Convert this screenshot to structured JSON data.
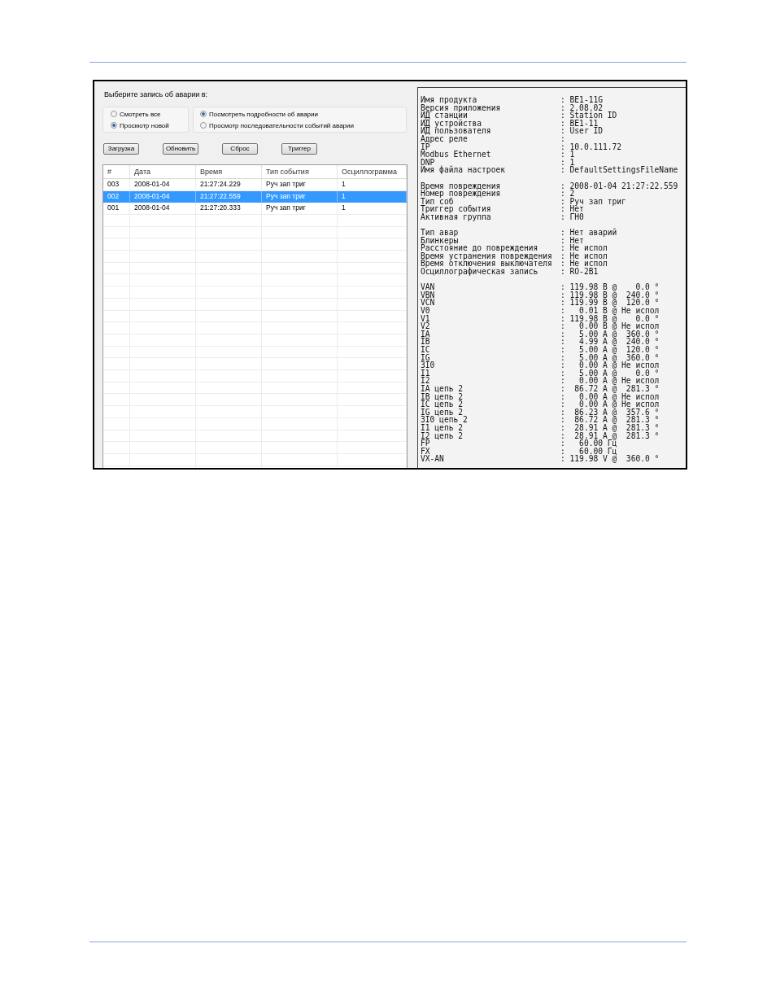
{
  "fault_dialog": {
    "prompt": "Выберите запись об аварии в:",
    "view_group": [
      {
        "label": "Смотреть все",
        "selected": false
      },
      {
        "label": "Просмотр новой",
        "selected": true
      }
    ],
    "detail_group": [
      {
        "label": "Посмотреть подробности об аварии",
        "selected": true
      },
      {
        "label": "Просмотр последовательности событий аварии",
        "selected": false
      }
    ],
    "buttons": [
      "Загрузка",
      "Обновить",
      "Сброс",
      "Триггер"
    ],
    "table": {
      "columns": [
        "#",
        "Дата",
        "Время",
        "Тип события",
        "Осциллограмма"
      ],
      "rows": [
        {
          "cells": [
            "003",
            "2008-01-04",
            "21:27:24.229",
            "Руч зап триг",
            "1"
          ],
          "selected": false
        },
        {
          "cells": [
            "002",
            "2008-01-04",
            "21:27:22.559",
            "Руч зап триг",
            "1"
          ],
          "selected": true
        },
        {
          "cells": [
            "001",
            "2008-01-04",
            "21:27:20.333",
            "Руч зап триг",
            "1"
          ],
          "selected": false
        }
      ]
    }
  },
  "report": {
    "sections": [
      {
        "rows": [
          {
            "label": "Имя продукта",
            "value": ": BE1-11G"
          },
          {
            "label": "Версия приложения",
            "value": ": 2.08.02"
          },
          {
            "label": "ИД станции",
            "value": ": Station ID"
          },
          {
            "label": "ИД устройства",
            "value": ": BE1-11"
          },
          {
            "label": "ИД пользователя",
            "value": ": User ID"
          },
          {
            "label": "Адрес реле",
            "value": ":"
          },
          {
            "label": "IP",
            "value": ": 10.0.111.72"
          },
          {
            "label": "Modbus Ethernet",
            "value": ": 1"
          },
          {
            "label": "DNP",
            "value": ": 1"
          },
          {
            "label": "Имя файла настроек",
            "value": ": DefaultSettingsFileName"
          }
        ]
      },
      {
        "rows": [
          {
            "label": "Время повреждения",
            "value": ": 2008-01-04 21:27:22.559"
          },
          {
            "label": "Номер повреждения",
            "value": ": 2"
          },
          {
            "label": "Тип соб",
            "value": ": Руч зап триг"
          },
          {
            "label": "Триггер события",
            "value": ": Нет"
          },
          {
            "label": "Активная группа",
            "value": ": ГН0"
          }
        ]
      },
      {
        "rows": [
          {
            "label": "Тип авар",
            "value": ": Нет аварий"
          },
          {
            "label": "Блинкеры",
            "value": ": Нет"
          },
          {
            "label": "Расстояние до повреждения",
            "value": ": Не испол"
          },
          {
            "label": "Время устранения повреждения",
            "value": ": Не испол"
          },
          {
            "label": "Время отключения выключателя",
            "value": ": Не испол"
          },
          {
            "label": "Осциллографическая запись",
            "value": ": RO-2B1"
          }
        ]
      },
      {
        "rows": [
          {
            "label": "VAN",
            "value": ": 119.98 В @    0.0 °"
          },
          {
            "label": "VBN",
            "value": ": 119.98 В @  240.0 °"
          },
          {
            "label": "VCN",
            "value": ": 119.99 В @  120.0 °"
          },
          {
            "label": "V0",
            "value": ":   0.01 В @ Не испол"
          },
          {
            "label": "V1",
            "value": ": 119.98 В @    0.0 °"
          },
          {
            "label": "V2",
            "value": ":   0.00 В @ Не испол"
          },
          {
            "label": "IA",
            "value": ":   5.00 А @  360.0 °"
          },
          {
            "label": "IB",
            "value": ":   4.99 А @  240.0 °"
          },
          {
            "label": "IC",
            "value": ":   5.00 А @  120.0 °"
          },
          {
            "label": "IG",
            "value": ":   5.00 А @  360.0 °"
          },
          {
            "label": "3I0",
            "value": ":   0.00 А @ Не испол"
          },
          {
            "label": "I1",
            "value": ":   5.00 А @    0.0 °"
          },
          {
            "label": "I2",
            "value": ":   0.00 А @ Не испол"
          },
          {
            "label": "IA цепь 2",
            "value": ":  86.72 А @  281.3 °"
          },
          {
            "label": "IB цепь 2",
            "value": ":   0.00 А @ Не испол"
          },
          {
            "label": "IC цепь 2",
            "value": ":   0.00 А @ Не испол"
          },
          {
            "label": "IG цепь 2",
            "value": ":  86.23 А @  357.6 °"
          },
          {
            "label": "3I0 цепь 2",
            "value": ":  86.72 А @  281.3 °"
          },
          {
            "label": "I1 цепь 2",
            "value": ":  28.91 А @  281.3 °"
          },
          {
            "label": "I2 цепь 2",
            "value": ":  28.91 А @  281.3 °"
          },
          {
            "label": "FP",
            "value": ":   60.00 Гц"
          },
          {
            "label": "FX",
            "value": ":   60.00 Гц"
          },
          {
            "label": "VX-AN",
            "value": ": 119.98 V @  360.0 °"
          }
        ]
      }
    ]
  }
}
